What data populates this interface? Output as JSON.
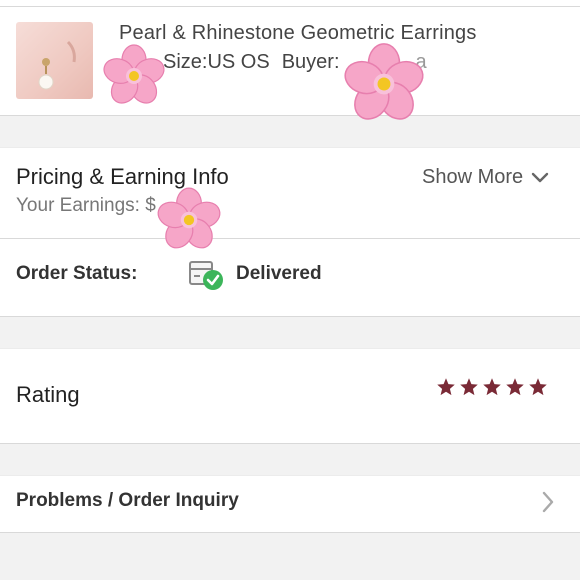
{
  "item": {
    "title": "Pearl & Rhinestone Geometric Earrings",
    "size": "Size:US OS",
    "buyer_label": "Buyer:",
    "buyer_tail": "a"
  },
  "pricing": {
    "title": "Pricing & Earning Info",
    "earnings_label": "Your Earnings: $",
    "show_more": "Show More"
  },
  "order_status": {
    "label": "Order Status:",
    "value": "Delivered",
    "status_color": "#3cb55a"
  },
  "rating": {
    "label": "Rating",
    "stars": 5,
    "star_color": "#7a2a36"
  },
  "problems": {
    "label": "Problems / Order Inquiry"
  },
  "icons": {
    "status": "package-delivered-icon",
    "chevron": "chevron-down-icon",
    "star": "star-icon",
    "nav": "chevron-right-icon",
    "sticker": "cherry-blossom-icon"
  }
}
